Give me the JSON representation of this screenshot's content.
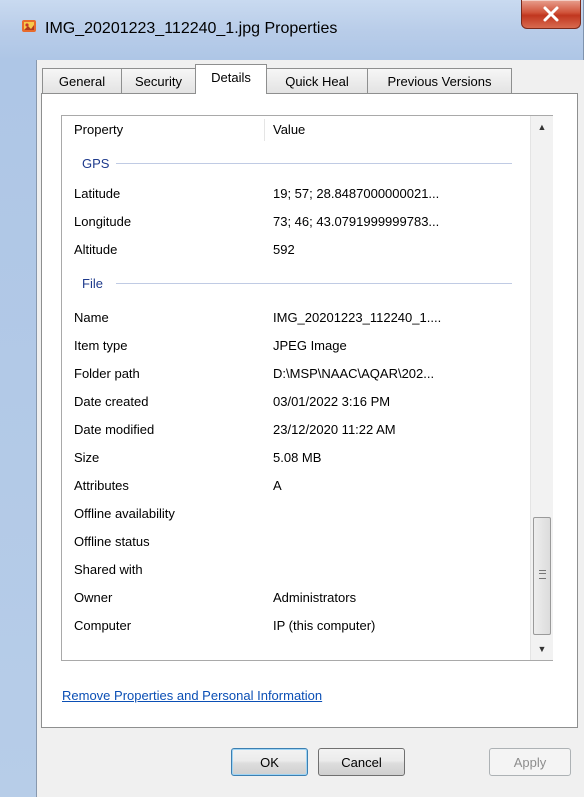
{
  "window": {
    "title": "IMG_20201223_112240_1.jpg Properties",
    "close_label": "X"
  },
  "tabs": [
    {
      "label": "General"
    },
    {
      "label": "Security"
    },
    {
      "label": "Details",
      "selected": true
    },
    {
      "label": "Quick Heal"
    },
    {
      "label": "Previous Versions"
    }
  ],
  "details": {
    "headers": {
      "property": "Property",
      "value": "Value"
    },
    "groups": {
      "gps": {
        "label": "GPS",
        "rows": [
          {
            "name": "Latitude",
            "value": "19; 57; 28.8487000000021..."
          },
          {
            "name": "Longitude",
            "value": "73; 46; 43.0791999999783..."
          },
          {
            "name": "Altitude",
            "value": "592"
          }
        ]
      },
      "file": {
        "label": "File",
        "rows": [
          {
            "name": "Name",
            "value": "IMG_20201223_112240_1...."
          },
          {
            "name": "Item type",
            "value": "JPEG Image"
          },
          {
            "name": "Folder path",
            "value": "D:\\MSP\\NAAC\\AQAR\\202..."
          },
          {
            "name": "Date created",
            "value": "03/01/2022 3:16 PM"
          },
          {
            "name": "Date modified",
            "value": "23/12/2020 11:22 AM"
          },
          {
            "name": "Size",
            "value": "5.08 MB"
          },
          {
            "name": "Attributes",
            "value": "A"
          },
          {
            "name": "Offline availability",
            "value": ""
          },
          {
            "name": "Offline status",
            "value": ""
          },
          {
            "name": "Shared with",
            "value": ""
          },
          {
            "name": "Owner",
            "value": "Administrators"
          },
          {
            "name": "Computer",
            "value": "IP (this computer)"
          }
        ]
      }
    }
  },
  "link_label": "Remove Properties and Personal Information",
  "buttons": {
    "ok": "OK",
    "cancel": "Cancel",
    "apply": "Apply"
  },
  "colors": {
    "group_header": "#1e3a8c",
    "link": "#0b4fb5",
    "close_button": "#c0361f"
  }
}
